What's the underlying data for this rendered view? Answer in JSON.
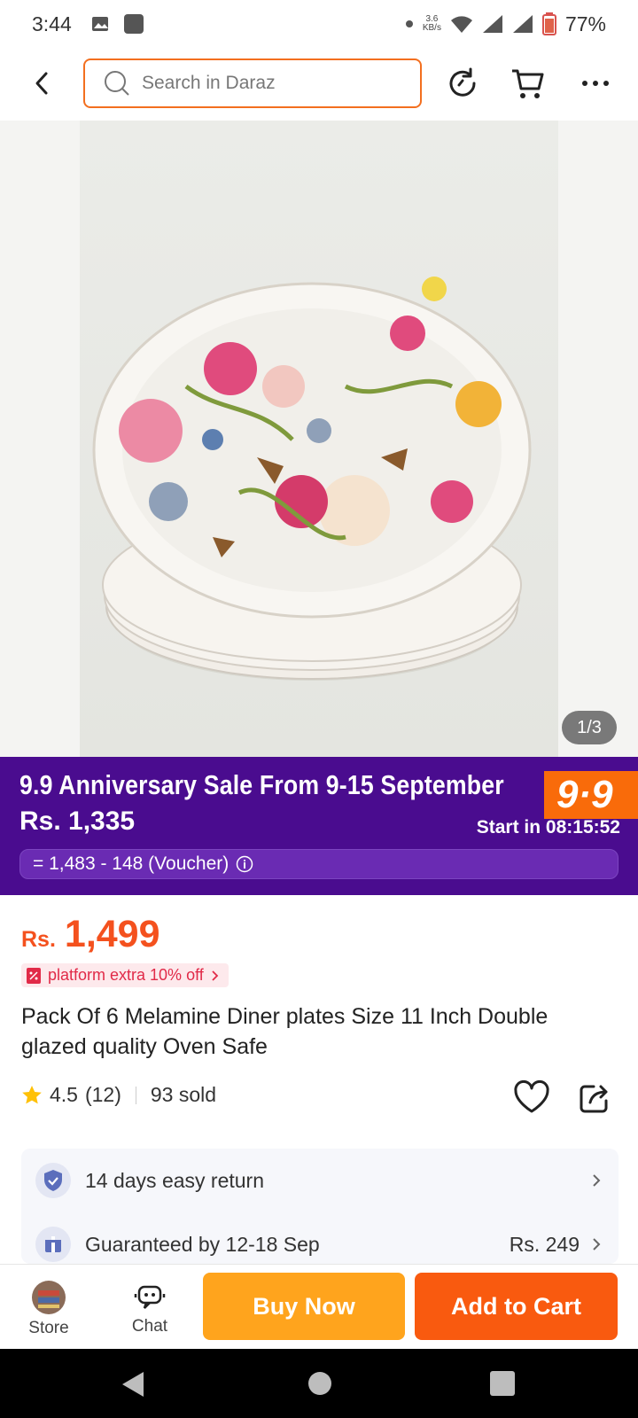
{
  "status_bar": {
    "time": "3:44",
    "net_speed_value": "3.6",
    "net_speed_unit": "KB/s",
    "battery": "77%"
  },
  "header": {
    "search_placeholder": "Search in Daraz"
  },
  "gallery": {
    "counter": "1/3"
  },
  "sale_banner": {
    "title": "9.9 Anniversary Sale From 9-15 September",
    "price": "Rs. 1,335",
    "start_text": "Start in 08:15:52",
    "badge": "9·9",
    "voucher_text": "= 1,483 - 148 (Voucher)",
    "bg_color": "#4a0c8f",
    "badge_color": "#f96b0a"
  },
  "price": {
    "currency": "Rs.",
    "value": "1,499",
    "promo": "platform extra 10% off",
    "color": "#f4511e"
  },
  "product": {
    "title": "Pack Of 6 Melamine Diner plates Size 11 Inch Double glazed quality Oven Safe",
    "rating": "4.5",
    "reviews": "(12)",
    "sold": "93 sold"
  },
  "services": {
    "return_text": "14 days easy return",
    "delivery_text": "Guaranteed by 12-18 Sep",
    "delivery_price": "Rs. 249"
  },
  "bottom_bar": {
    "store_label": "Store",
    "chat_label": "Chat",
    "buy_now": "Buy Now",
    "add_to_cart": "Add to Cart",
    "buy_color": "#ffa41d",
    "cart_color": "#f95a0f"
  }
}
